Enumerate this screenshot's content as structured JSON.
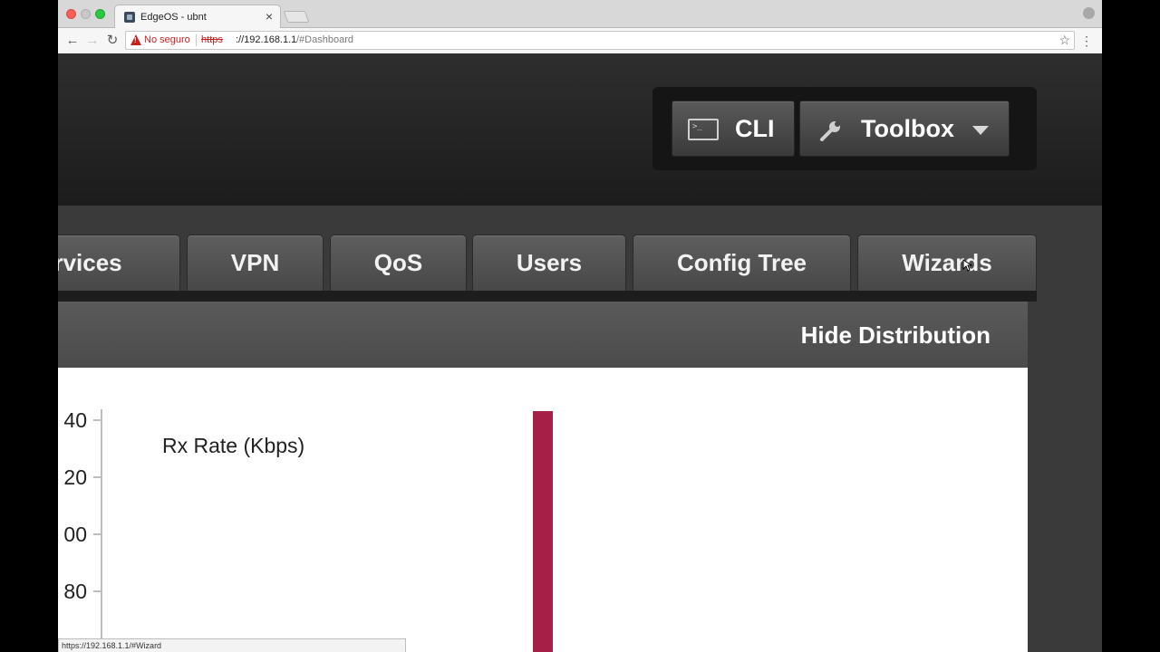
{
  "browser": {
    "tab_title": "EdgeOS - ubnt",
    "tab_close": "×",
    "security_label": "No seguro",
    "url_scheme": "https",
    "url_host": "://192.168.1.1",
    "url_path": "/#Dashboard",
    "status_url": "https://192.168.1.1/#Wizard"
  },
  "header": {
    "cli_label": "CLI",
    "toolbox_label": "Toolbox"
  },
  "nav": {
    "tabs": [
      {
        "label": "ervices"
      },
      {
        "label": "VPN"
      },
      {
        "label": "QoS"
      },
      {
        "label": "Users"
      },
      {
        "label": "Config Tree"
      },
      {
        "label": "Wizards"
      }
    ]
  },
  "distribution": {
    "toggle_label": "Hide Distribution"
  },
  "chart_data": {
    "type": "bar",
    "title": "Rx Rate (Kbps)",
    "y_tick_labels": [
      "40",
      "20",
      "00",
      "80"
    ],
    "bar_color": "#a51f47"
  }
}
